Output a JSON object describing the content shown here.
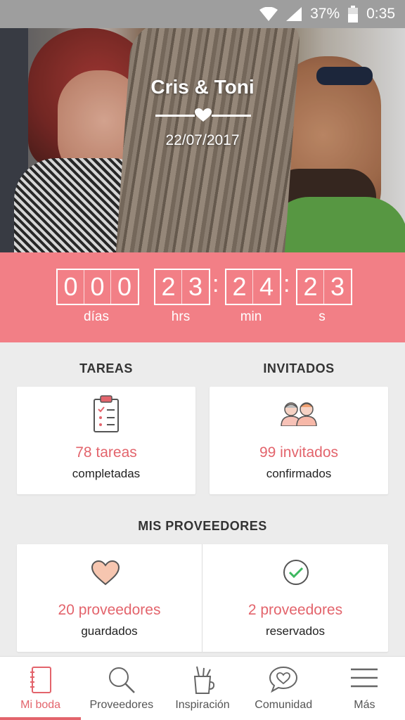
{
  "status_bar": {
    "battery": "37%",
    "time": "0:35",
    "icons": [
      "wifi-icon",
      "signal-icon",
      "battery-icon"
    ]
  },
  "hero": {
    "couple": "Cris & Toni",
    "date": "22/07/2017"
  },
  "countdown": {
    "days": [
      "0",
      "0",
      "0"
    ],
    "hours": [
      "2",
      "3"
    ],
    "minutes": [
      "2",
      "4"
    ],
    "seconds": [
      "2",
      "3"
    ],
    "separator": ":",
    "labels": {
      "days": "días",
      "hours": "hrs",
      "minutes": "min",
      "seconds": "s"
    }
  },
  "tasks": {
    "title": "TAREAS",
    "value": "78 tareas",
    "sub": "completadas",
    "icon": "clipboard-checklist-icon"
  },
  "guests": {
    "title": "INVITADOS",
    "value": "99 invitados",
    "sub": "confirmados",
    "icon": "guests-icon"
  },
  "vendors": {
    "title": "MIS PROVEEDORES",
    "saved": {
      "value": "20 proveedores",
      "sub": "guardados",
      "icon": "heart-icon"
    },
    "booked": {
      "value": "2 proveedores",
      "sub": "reservados",
      "icon": "check-circle-icon"
    }
  },
  "nav": {
    "items": [
      {
        "label": "Mi boda",
        "icon": "notebook-icon",
        "active": true
      },
      {
        "label": "Proveedores",
        "icon": "search-icon",
        "active": false
      },
      {
        "label": "Inspiración",
        "icon": "inspiration-icon",
        "active": false
      },
      {
        "label": "Comunidad",
        "icon": "chat-heart-icon",
        "active": false
      },
      {
        "label": "Más",
        "icon": "menu-icon",
        "active": false
      }
    ]
  },
  "colors": {
    "accent": "#f27f86",
    "accent_text": "#e3646c",
    "status_bar": "#9e9e9e"
  }
}
